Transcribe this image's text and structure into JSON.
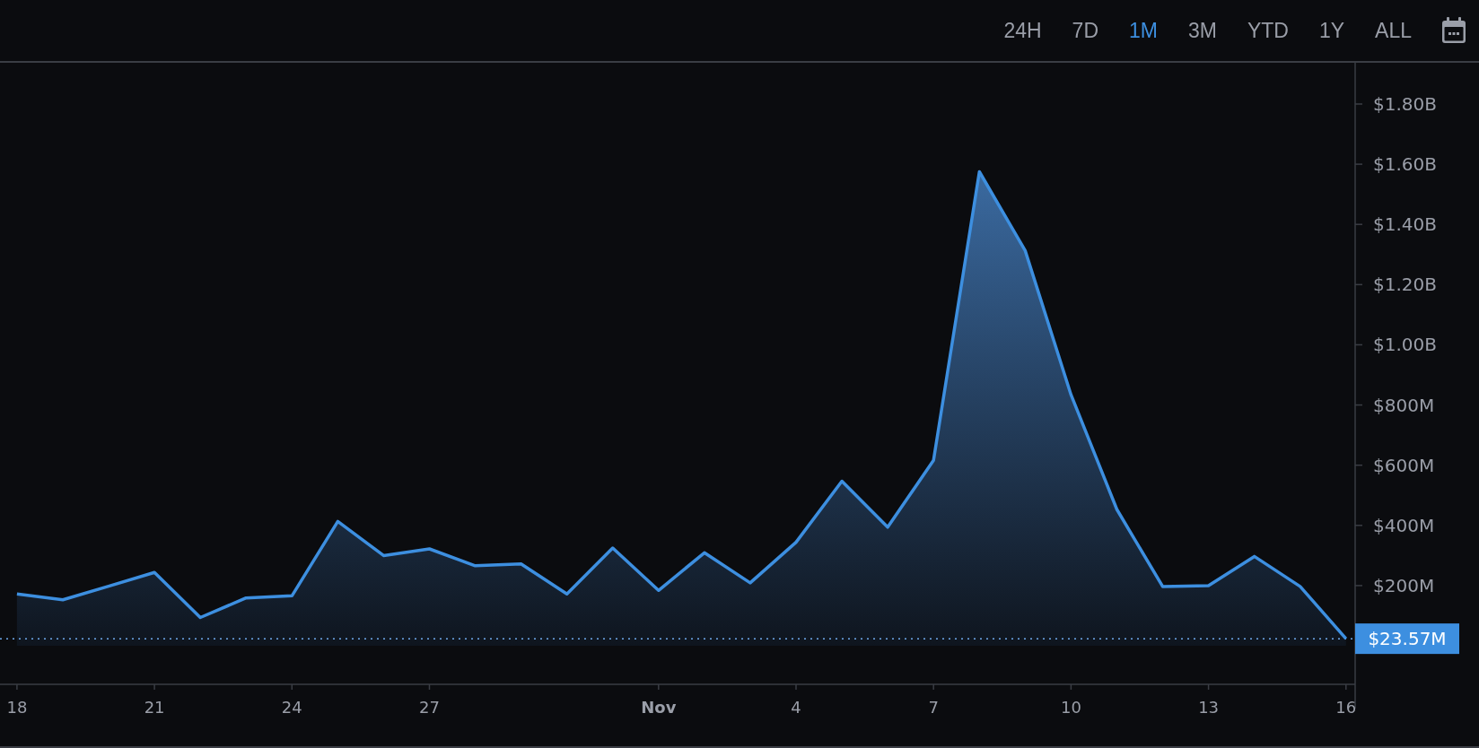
{
  "timeframes": [
    {
      "label": "24H",
      "selected": false
    },
    {
      "label": "7D",
      "selected": false
    },
    {
      "label": "1M",
      "selected": true
    },
    {
      "label": "3M",
      "selected": false
    },
    {
      "label": "YTD",
      "selected": false
    },
    {
      "label": "1Y",
      "selected": false
    },
    {
      "label": "ALL",
      "selected": false
    }
  ],
  "chart": {
    "chart_data": {
      "type": "area",
      "ref_lines": [
        {
          "axis": "y",
          "value": 23570000,
          "label": "$23.57M"
        }
      ],
      "categories": [
        "18",
        null,
        null,
        "21",
        null,
        null,
        "24",
        null,
        null,
        "27",
        null,
        null,
        null,
        null,
        "Nov",
        null,
        null,
        "4",
        null,
        null,
        "7",
        null,
        null,
        "10",
        null,
        null,
        "13",
        null,
        null,
        "16"
      ],
      "series": [
        {
          "color": "#3d8fe0",
          "values": [
            172000000,
            153000000,
            198000000,
            244000000,
            94000000,
            159000000,
            166000000,
            413000000,
            300000000,
            322000000,
            266000000,
            272000000,
            172000000,
            325000000,
            184000000,
            309000000,
            209000000,
            344000000,
            547000000,
            394000000,
            616000000,
            1575000000,
            1313000000,
            834000000,
            453000000,
            197000000,
            200000000,
            297000000,
            197000000,
            23570000
          ]
        }
      ],
      "ylim": [
        -128000000,
        1937000000
      ],
      "yticks": [
        {
          "value": 200000000,
          "label": "$200M"
        },
        {
          "value": 400000000,
          "label": "$400M"
        },
        {
          "value": 600000000,
          "label": "$600M"
        },
        {
          "value": 800000000,
          "label": "$800M"
        },
        {
          "value": 1000000000,
          "label": "$1.00B"
        },
        {
          "value": 1200000000,
          "label": "$1.20B"
        },
        {
          "value": 1400000000,
          "label": "$1.40B"
        },
        {
          "value": 1600000000,
          "label": "$1.60B"
        },
        {
          "value": 1800000000,
          "label": "$1.80B"
        }
      ]
    }
  }
}
